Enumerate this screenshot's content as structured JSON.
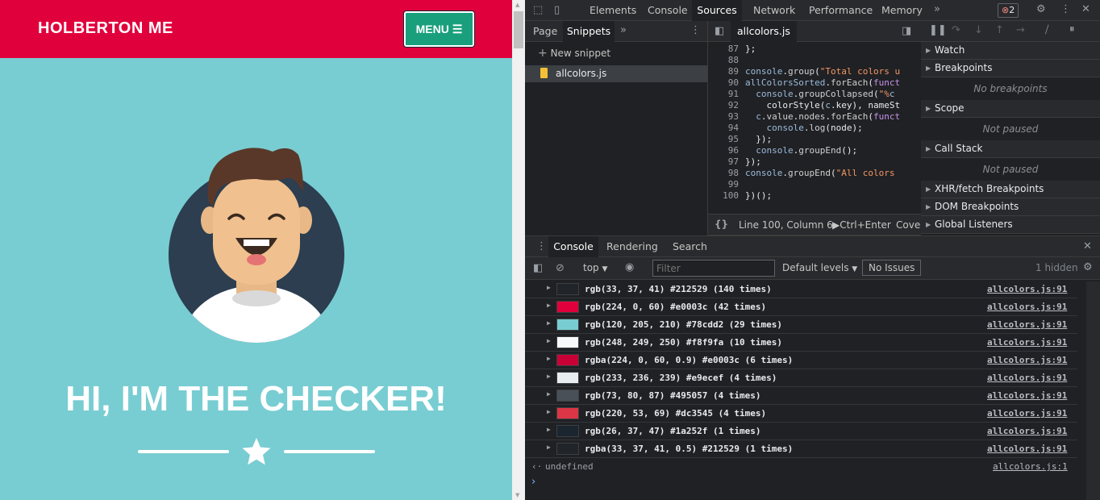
{
  "page": {
    "brand": "HOLBERTON ME",
    "menu_label": "MENU",
    "hero": "HI, I'M THE CHECKER!"
  },
  "devtools": {
    "main_tabs": [
      "Elements",
      "Console",
      "Sources",
      "Network",
      "Performance",
      "Memory"
    ],
    "active_main_tab": "Sources",
    "error_count": "2",
    "nav_tabs": [
      "Page",
      "Snippets"
    ],
    "new_snippet": "New snippet",
    "snippet_file": "allcolors.js",
    "editor_tab": "allcolors.js",
    "code_lines": [
      {
        "n": "87",
        "t": "};"
      },
      {
        "n": "88",
        "t": ""
      },
      {
        "n": "89",
        "t": "console.group(\"Total colors u"
      },
      {
        "n": "90",
        "t": "allColorsSorted.forEach(funct"
      },
      {
        "n": "91",
        "t": "  console.groupCollapsed(\"%c"
      },
      {
        "n": "92",
        "t": "    colorStyle(c.key), nameSt"
      },
      {
        "n": "93",
        "t": "  c.value.nodes.forEach(funct"
      },
      {
        "n": "94",
        "t": "    console.log(node);"
      },
      {
        "n": "95",
        "t": "  });"
      },
      {
        "n": "96",
        "t": "  console.groupEnd();"
      },
      {
        "n": "97",
        "t": "});"
      },
      {
        "n": "98",
        "t": "console.groupEnd(\"All colors"
      },
      {
        "n": "99",
        "t": ""
      },
      {
        "n": "100",
        "t": "})();"
      }
    ],
    "status_position": "Line 100, Column 6",
    "status_run": "Ctrl+Enter",
    "status_coverage": "Cove",
    "sidebar": [
      {
        "title": "Watch",
        "note": ""
      },
      {
        "title": "Breakpoints",
        "note": "No breakpoints"
      },
      {
        "title": "Scope",
        "note": "Not paused"
      },
      {
        "title": "Call Stack",
        "note": "Not paused"
      },
      {
        "title": "XHR/fetch Breakpoints",
        "note": ""
      },
      {
        "title": "DOM Breakpoints",
        "note": ""
      },
      {
        "title": "Global Listeners",
        "note": ""
      }
    ],
    "drawer_tabs": [
      "Console",
      "Rendering",
      "Search"
    ],
    "console_context": "top",
    "filter_placeholder": "Filter",
    "levels": "Default levels",
    "issues": "No Issues",
    "hidden": "1 hidden",
    "logs": [
      {
        "swatch": "#212529",
        "text": "rgb(33, 37, 41) #212529 (140 times)",
        "src": "allcolors.js:91"
      },
      {
        "swatch": "#e0003c",
        "text": "rgb(224, 0, 60) #e0003c (42 times)",
        "src": "allcolors.js:91"
      },
      {
        "swatch": "#78cdd2",
        "text": "rgb(120, 205, 210) #78cdd2 (29 times)",
        "src": "allcolors.js:91"
      },
      {
        "swatch": "#f8f9fa",
        "text": "rgb(248, 249, 250) #f8f9fa (10 times)",
        "src": "allcolors.js:91"
      },
      {
        "swatch": "#c90035",
        "text": "rgba(224, 0, 60, 0.9) #e0003c (6 times)",
        "src": "allcolors.js:91"
      },
      {
        "swatch": "#e9ecef",
        "text": "rgb(233, 236, 239) #e9ecef (4 times)",
        "src": "allcolors.js:91"
      },
      {
        "swatch": "#495057",
        "text": "rgb(73, 80, 87) #495057 (4 times)",
        "src": "allcolors.js:91"
      },
      {
        "swatch": "#dc3545",
        "text": "rgb(220, 53, 69) #dc3545 (4 times)",
        "src": "allcolors.js:91"
      },
      {
        "swatch": "#1a252f",
        "text": "rgb(26, 37, 47) #1a252f (1 times)",
        "src": "allcolors.js:91"
      },
      {
        "swatch": "#212529",
        "text": "rgba(33, 37, 41, 0.5) #212529 (1 times)",
        "src": "allcolors.js:91"
      }
    ],
    "result": "undefined",
    "result_src": "allcolors.js:1"
  }
}
